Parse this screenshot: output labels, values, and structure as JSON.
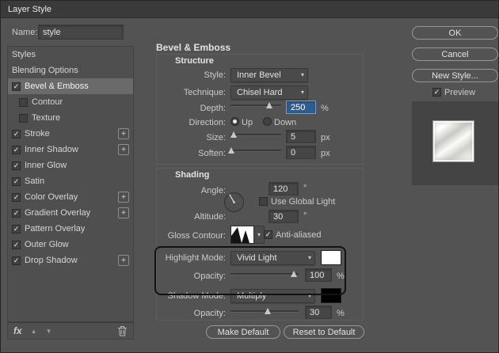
{
  "window": {
    "title": "Layer Style"
  },
  "colors": {
    "dialog_bg": "#535353",
    "titlebar_bg": "#3a3a3a",
    "selection_blue": "#2e5d90",
    "annotation_border": "#121212",
    "highlight_swatch": "#ffffff",
    "shadow_swatch": "#000000"
  },
  "icons": {
    "plus": "+",
    "check": "✓",
    "dropdown": "▾",
    "up": "▲",
    "down": "▼"
  },
  "name_row": {
    "label": "Name:",
    "value": "style"
  },
  "sidebar": {
    "items": [
      {
        "label": "Styles"
      },
      {
        "label": "Blending Options"
      },
      {
        "label": "Bevel & Emboss"
      },
      {
        "label": "Contour"
      },
      {
        "label": "Texture"
      },
      {
        "label": "Stroke"
      },
      {
        "label": "Inner Shadow"
      },
      {
        "label": "Inner Glow"
      },
      {
        "label": "Satin"
      },
      {
        "label": "Color Overlay"
      },
      {
        "label": "Gradient Overlay"
      },
      {
        "label": "Pattern Overlay"
      },
      {
        "label": "Outer Glow"
      },
      {
        "label": "Drop Shadow"
      }
    ]
  },
  "sidebar_footer": {
    "fx": "fx"
  },
  "panel": {
    "title": "Bevel & Emboss",
    "structure": {
      "heading": "Structure",
      "style_label": "Style:",
      "style_value": "Inner Bevel",
      "technique_label": "Technique:",
      "technique_value": "Chisel Hard",
      "depth_label": "Depth:",
      "depth_value": "250",
      "depth_unit": "%",
      "direction_label": "Direction:",
      "direction_up": "Up",
      "direction_down": "Down",
      "size_label": "Size:",
      "size_value": "5",
      "size_unit": "px",
      "soften_label": "Soften:",
      "soften_value": "0",
      "soften_unit": "px"
    },
    "shading": {
      "heading": "Shading",
      "angle_label": "Angle:",
      "angle_value": "120",
      "angle_unit": "°",
      "global_light_label": "Use Global Light",
      "altitude_label": "Altitude:",
      "altitude_value": "30",
      "altitude_unit": "°",
      "gloss_label": "Gloss Contour:",
      "anti_aliased_label": "Anti-aliased",
      "highlight_label": "Highlight Mode:",
      "highlight_value": "Vivid Light",
      "highlight_opacity_label": "Opacity:",
      "highlight_opacity_value": "100",
      "highlight_opacity_unit": "%",
      "shadow_label": "Shadow Mode:",
      "shadow_value": "Multiply",
      "shadow_opacity_label": "Opacity:",
      "shadow_opacity_value": "30",
      "shadow_opacity_unit": "%"
    },
    "footer": {
      "make_default": "Make Default",
      "reset_default": "Reset to Default"
    }
  },
  "actions": {
    "ok": "OK",
    "cancel": "Cancel",
    "new_style": "New Style...",
    "preview": "Preview"
  }
}
